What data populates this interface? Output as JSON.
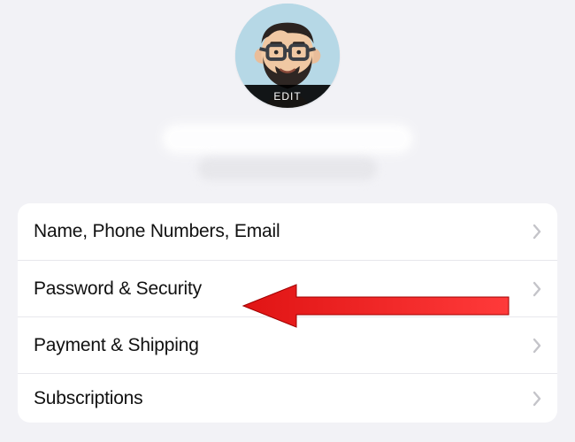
{
  "profile": {
    "edit_label": "EDIT"
  },
  "settings": {
    "items": [
      {
        "label": "Name, Phone Numbers, Email"
      },
      {
        "label": "Password & Security"
      },
      {
        "label": "Payment & Shipping"
      },
      {
        "label": "Subscriptions"
      }
    ]
  }
}
